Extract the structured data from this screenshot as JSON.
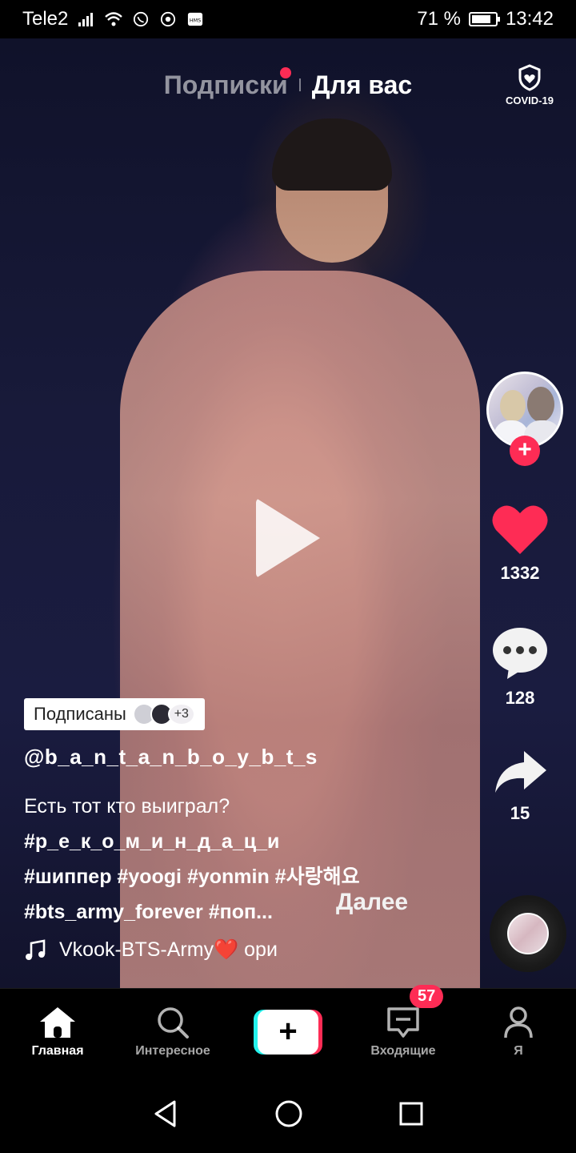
{
  "status_bar": {
    "carrier": "Tele2",
    "battery_percent": "71 %",
    "battery_level": 0.71,
    "time": "13:42"
  },
  "top_tabs": {
    "following": "Подписки",
    "for_you": "Для вас",
    "covid_label": "COVID-19"
  },
  "video": {
    "followed_label": "Подписаны",
    "followed_extra": "+3",
    "username": "@b_a_n_t_a_n_b_o_y_b_t_s",
    "caption_line": "Есть тот кто выиграл?",
    "tags_line_1": "#р_е_к_о_м_и_н_д_а_ц_и",
    "tags_line_2": "#шиппер #yoogi #yonmin #사랑해요",
    "tags_line_3": "#bts_army_forever #поп...",
    "more_label": "Далее",
    "sound_text": "Vkook-BTS-Army❤️    ори"
  },
  "actions": {
    "likes": "1332",
    "comments": "128",
    "shares": "15"
  },
  "bottom_nav": {
    "home": "Главная",
    "discover": "Интересное",
    "inbox": "Входящие",
    "inbox_badge": "57",
    "profile": "Я"
  },
  "colors": {
    "accent": "#fe2c55",
    "cyan": "#25f4ee"
  }
}
